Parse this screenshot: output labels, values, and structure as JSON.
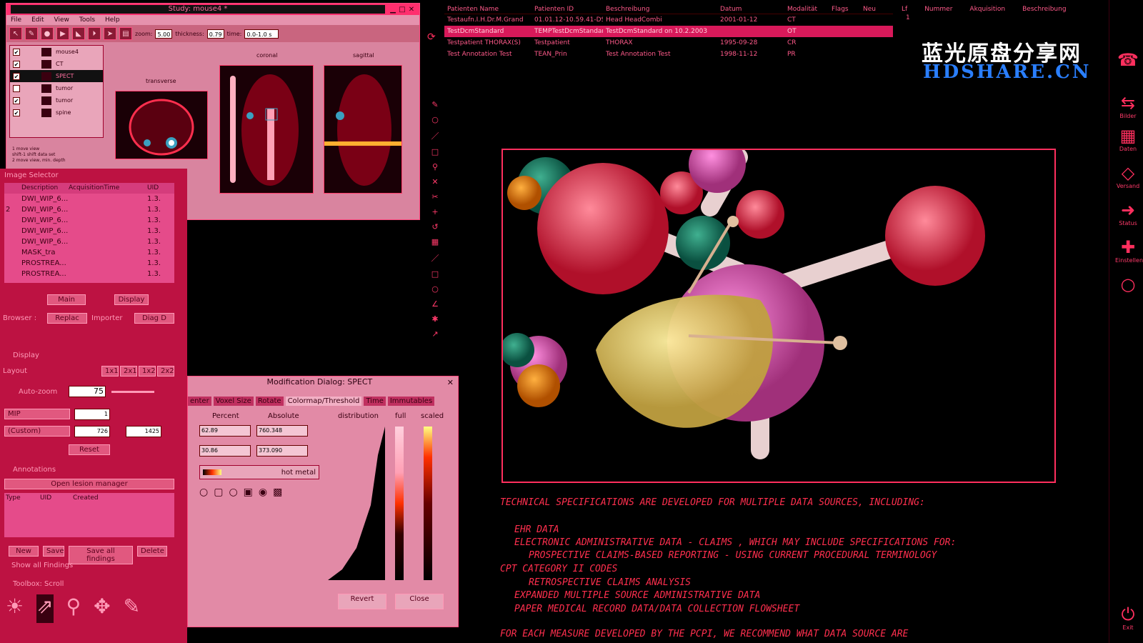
{
  "study_window": {
    "title": "Study: mouse4 *",
    "menu": [
      "File",
      "Edit",
      "View",
      "Tools",
      "Help"
    ],
    "zoom_label": "zoom:",
    "zoom_value": "5.00",
    "thickness_label": "thickness:",
    "thickness_value": "0.79",
    "time_label": "time:",
    "time_value": "0.0-1.0 s"
  },
  "tree": {
    "items": [
      {
        "label": "mouse4",
        "checked": true
      },
      {
        "label": "CT",
        "checked": true
      },
      {
        "label": "SPECT",
        "checked": true
      },
      {
        "label": "tumor",
        "checked": false
      },
      {
        "label": "tumor",
        "checked": true
      },
      {
        "label": "spine",
        "checked": true
      }
    ]
  },
  "help_text": [
    "1   move view",
    "shift-1   shift data set",
    "2   move view, min. depth"
  ],
  "views": {
    "transverse": "transverse",
    "coronal": "coronal",
    "sagittal": "sagittal"
  },
  "image_selector": {
    "title": "Image Selector",
    "columns": [
      "Description",
      "AcquisitionTime",
      "UID"
    ],
    "rows": [
      {
        "n": "",
        "d": "DWI_WIP_6...",
        "u": "1.3."
      },
      {
        "n": "2",
        "d": "DWI_WIP_6...",
        "u": "1.3."
      },
      {
        "n": "",
        "d": "DWI_WIP_6...",
        "u": "1.3."
      },
      {
        "n": "",
        "d": "DWI_WIP_6...",
        "u": "1.3."
      },
      {
        "n": "",
        "d": "DWI_WIP_6...",
        "u": "1.3."
      },
      {
        "n": "",
        "d": "MASK_tra",
        "u": "1.3."
      },
      {
        "n": "",
        "d": "PROSTREA...",
        "u": "1.3."
      },
      {
        "n": "",
        "d": "PROSTREA...",
        "u": "1.3."
      }
    ],
    "main": "Main",
    "display": "Display",
    "browser": "Browser :",
    "replace": "Replac",
    "importer": "Importer",
    "diag": "Diag D"
  },
  "display": {
    "title": "Display",
    "layout": "Layout",
    "layouts": [
      "1x1",
      "2x1",
      "1x2",
      "2x2"
    ],
    "autozoom_label": "Auto-zoom",
    "autozoom": "75",
    "mip": "MIP",
    "mip_value": "1",
    "custom": "(Custom)",
    "v1": "726",
    "v2": "1425",
    "reset": "Reset"
  },
  "annotations": {
    "title": "Annotations",
    "open": "Open lesion manager",
    "columns": [
      "Type",
      "UID",
      "Created"
    ],
    "new": "New",
    "save": "Save",
    "save_all": "Save all findings",
    "delete": "Delete",
    "show_all": "Show all Findings"
  },
  "toolbox": {
    "title": "Toolbox: Scroll"
  },
  "mod_dialog": {
    "title": "Modification Dialog: SPECT",
    "tabs": [
      "enter",
      "Voxel Size",
      "Rotate",
      "Colormap/Threshold",
      "Time",
      "Immutables"
    ],
    "percent": "Percent",
    "absolute": "Absolute",
    "distribution": "distribution",
    "full": "full",
    "scaled": "scaled",
    "p1": "62.89",
    "a1": "760.348",
    "p2": "30.86",
    "a2": "373.090",
    "colormap": "hot metal",
    "revert": "Revert",
    "close": "Close"
  },
  "patients": {
    "columns": [
      "Patienten Name",
      "Patienten ID",
      "Beschreibung",
      "Datum",
      "Modalität",
      "Flags",
      "Neu"
    ],
    "rows": [
      [
        "Testaufn.I.H.Dr.M.Grand",
        "01.01.12-10.59.41-DST",
        "Head HeadCombi",
        "2001-01-12",
        "CT",
        "",
        ""
      ],
      [
        "TestDcmStandard",
        "TEMPTestDcmStandard",
        "TestDcmStandard on 10.2.2003",
        "",
        "OT",
        "",
        ""
      ],
      [
        "Testpatient THORAX(S)",
        "Testpatient",
        "THORAX",
        "1995-09-28",
        "CR",
        "",
        ""
      ],
      [
        "Test Annotation Test",
        "TEAN_Prin",
        "Test Annotation Test",
        "1998-11-12",
        "PR",
        "",
        ""
      ]
    ],
    "right_cols": [
      "Lf",
      "Nummer",
      "Akquisition",
      "Beschreibung"
    ],
    "right_val": "1"
  },
  "watermark": {
    "cn": "蓝光原盘分享网",
    "en": "HDSHARE.CN"
  },
  "sidebar": [
    {
      "icon": "☎",
      "label": ""
    },
    {
      "icon": "⇆",
      "label": "Bilder"
    },
    {
      "icon": "▦",
      "label": "Daten"
    },
    {
      "icon": "◇",
      "label": "Versand"
    },
    {
      "icon": "➜",
      "label": "Status"
    },
    {
      "icon": "✚",
      "label": "Einstellen"
    },
    {
      "icon": "○",
      "label": ""
    },
    {
      "icon": "⏻",
      "label": "Exit"
    }
  ],
  "spec": [
    "Technical specifications are developed for multiple data sources, including:",
    "EHR data",
    "Electronic administrative data - claims , which may include specifications for:",
    "Prospective claims-based reporting - using current procedural terminology",
    "CPT Category II codes",
    "Retrospective claims analysis",
    "Expanded multiple source administrative data",
    "Paper medical record data/data collection flowsheet",
    "For each measure developed by the PCPI, we recommend what data source are"
  ]
}
